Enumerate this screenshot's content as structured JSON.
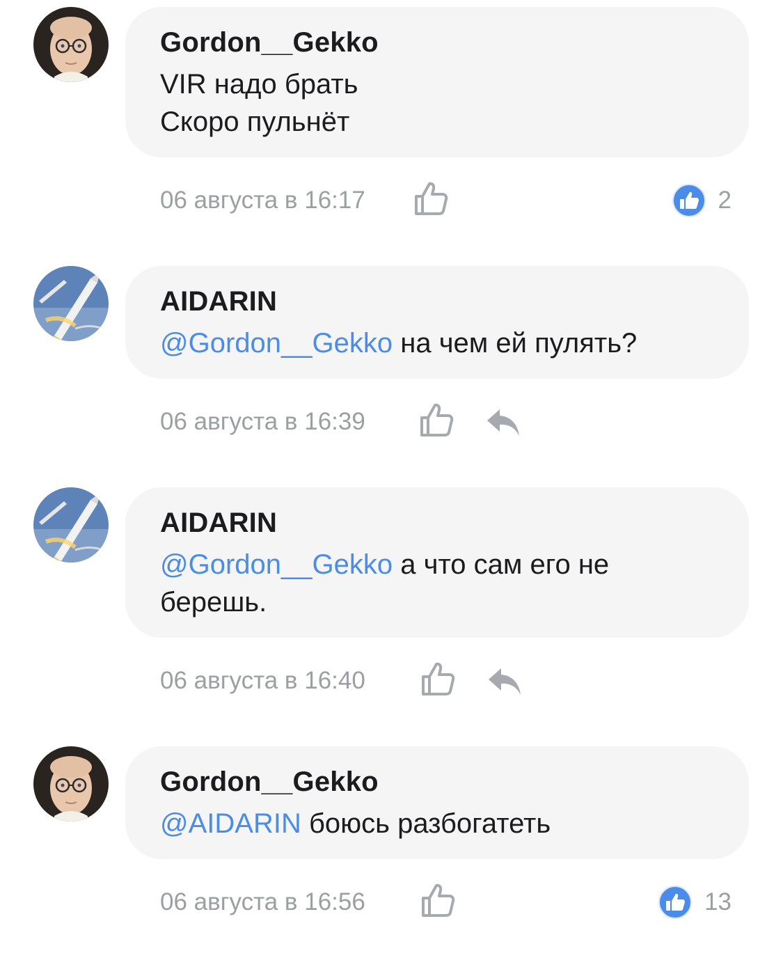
{
  "comments": [
    {
      "author": "Gordon__Gekko",
      "mention": "",
      "text": "VIR надо брать\nСкоро пульнёт",
      "time": "06 августа в 16:17",
      "likes": "2"
    },
    {
      "author": "AIDARIN",
      "mention": "@Gordon__Gekko",
      "text": " на чем ей пулять?",
      "time": "06 августа в 16:39",
      "likes": ""
    },
    {
      "author": "AIDARIN",
      "mention": "@Gordon__Gekko",
      "text": "  а что сам его не берешь.",
      "time": "06 августа в 16:40",
      "likes": ""
    },
    {
      "author": "Gordon__Gekko",
      "mention": "@AIDARIN",
      "text": " боюсь разбогатеть",
      "time": "06 августа в 16:56",
      "likes": "13"
    }
  ],
  "icons": {
    "like": "thumbs-up-outline-icon",
    "like_badge": "thumbs-up-filled-icon",
    "reply": "reply-arrow-icon"
  },
  "colors": {
    "mention": "#4a8ce8",
    "bubble": "#f5f5f6",
    "meta_text": "#9b9ea3",
    "like_badge": "#4a8ce8"
  }
}
